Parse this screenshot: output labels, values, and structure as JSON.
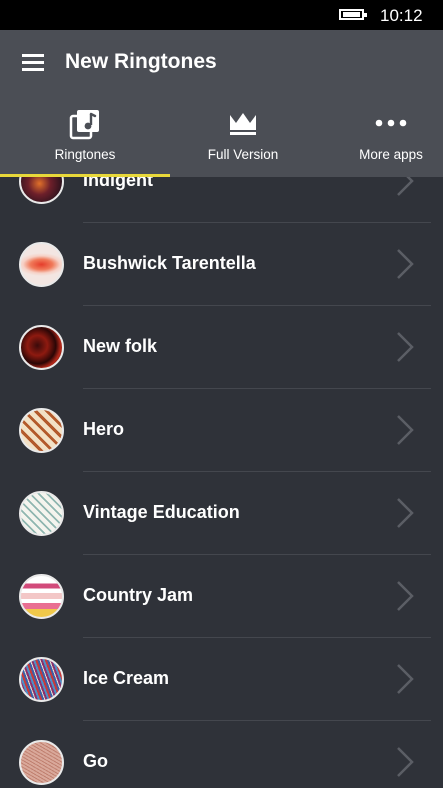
{
  "status": {
    "time": "10:12"
  },
  "header": {
    "title": "New Ringtones"
  },
  "tabs": [
    {
      "label": "Ringtones",
      "icon": "music-library-icon",
      "active": true
    },
    {
      "label": "Full Version",
      "icon": "crown-icon",
      "active": false
    },
    {
      "label": "More apps",
      "icon": "more-dots-icon",
      "active": false
    }
  ],
  "colors": {
    "accent": "#e8d83a",
    "appbar": "#4b4e55",
    "background": "#2f3239"
  },
  "ringtones": [
    {
      "name": "Indigent"
    },
    {
      "name": "Bushwick Tarentella"
    },
    {
      "name": "New folk"
    },
    {
      "name": "Hero"
    },
    {
      "name": "Vintage Education"
    },
    {
      "name": "Country Jam"
    },
    {
      "name": "Ice Cream"
    },
    {
      "name": "Go"
    }
  ]
}
